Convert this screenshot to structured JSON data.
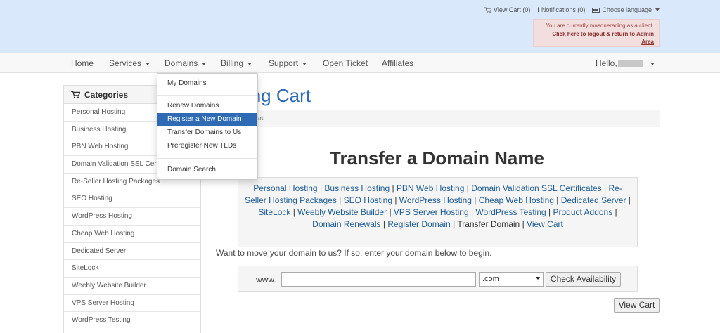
{
  "top_links": {
    "view_cart": "View Cart (0)",
    "notifications": "Notifications (0)",
    "language": "Choose language"
  },
  "masquerade": {
    "line1": "You are currently masquerading as a client.",
    "line2": "Click here to logout & return to Admin",
    "line3": "Area"
  },
  "nav": {
    "home": "Home",
    "services": "Services",
    "domains": "Domains",
    "billing": "Billing",
    "support": "Support",
    "open_ticket": "Open Ticket",
    "affiliates": "Affiliates",
    "hello": "Hello,"
  },
  "domains_menu": {
    "items": [
      "My Domains",
      "Renew Domains",
      "Register a New Domain",
      "Transfer Domains to Us",
      "Preregister New TLDs",
      "Domain Search"
    ],
    "active": "Register a New Domain"
  },
  "sidebar": {
    "title": "Categories",
    "items": [
      "Personal Hosting",
      "Business Hosting",
      "PBN Web Hosting",
      "Domain Validation SSL Certificates",
      "Re-Seller Hosting Packages",
      "SEO Hosting",
      "WordPress Hosting",
      "Cheap Web Hosting",
      "Dedicated Server",
      "SiteLock",
      "Weebly Website Builder",
      "VPS Server Hosting",
      "WordPress Testing"
    ]
  },
  "page": {
    "title_visible": "pping Cart",
    "breadcrumb_visible": "art",
    "heading": "Transfer a Domain Name",
    "intro": "Want to move your domain to us? If so, enter your domain below to begin."
  },
  "links": {
    "items": [
      "Personal Hosting",
      "Business Hosting",
      "PBN Web Hosting",
      "Domain Validation SSL Certificates",
      "Re-Seller Hosting Packages",
      "SEO Hosting",
      "WordPress Hosting",
      "Cheap Web Hosting",
      "Dedicated Server",
      "SiteLock",
      "Weebly Website Builder",
      "VPS Server Hosting",
      "WordPress Testing",
      "Product Addons",
      "Domain Renewals",
      "Register Domain",
      "Transfer Domain",
      "View Cart"
    ],
    "current": "Transfer Domain",
    "separator": " | "
  },
  "form": {
    "www_label": "www.",
    "domain_value": "",
    "tld_value": ".com",
    "check_button": "Check Availability",
    "view_cart_button": "View Cart"
  },
  "colors": {
    "header_bg": "#d9e8fb",
    "link": "#1d5c96",
    "active_menu": "#2e6bb4",
    "alert_bg": "#f2dede"
  }
}
